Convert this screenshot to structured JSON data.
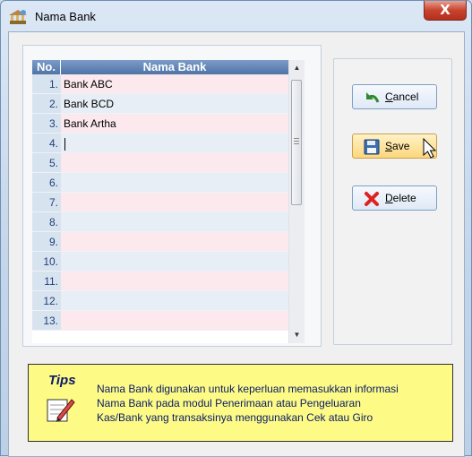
{
  "window": {
    "title": "Nama Bank",
    "close_label": "X"
  },
  "grid": {
    "headers": {
      "no": "No.",
      "name": "Nama Bank"
    },
    "rows": [
      {
        "no": "1.",
        "name": "Bank ABC"
      },
      {
        "no": "2.",
        "name": "Bank BCD"
      },
      {
        "no": "3.",
        "name": "Bank Artha"
      },
      {
        "no": "4.",
        "name": ""
      },
      {
        "no": "5.",
        "name": ""
      },
      {
        "no": "6.",
        "name": ""
      },
      {
        "no": "7.",
        "name": ""
      },
      {
        "no": "8.",
        "name": ""
      },
      {
        "no": "9.",
        "name": ""
      },
      {
        "no": "10.",
        "name": ""
      },
      {
        "no": "11.",
        "name": ""
      },
      {
        "no": "12.",
        "name": ""
      },
      {
        "no": "13.",
        "name": ""
      }
    ]
  },
  "buttons": {
    "cancel": {
      "mnemonic": "C",
      "rest": "ancel"
    },
    "save": {
      "mnemonic": "S",
      "rest": "ave"
    },
    "delete": {
      "mnemonic": "D",
      "rest": "elete"
    }
  },
  "tips": {
    "title": "Tips",
    "lines": [
      "Nama Bank digunakan untuk keperluan memasukkan informasi",
      "Nama Bank pada modul Penerimaan atau Pengeluaran",
      "Kas/Bank yang transaksinya menggunakan Cek atau Giro"
    ]
  },
  "icons": {
    "window": "bank-building-icon",
    "cancel": "undo-arrow-icon",
    "save": "floppy-disk-icon",
    "delete": "red-x-icon",
    "tips": "notepad-pencil-icon",
    "cursor": "mouse-pointer-icon"
  },
  "colors": {
    "header_bg": "#5a7db0",
    "row_odd": "#fbe9ee",
    "row_even": "#e7eef6",
    "tips_bg": "#fdfb86",
    "tips_text": "#0a1a66",
    "close_bg": "#c8432e"
  }
}
